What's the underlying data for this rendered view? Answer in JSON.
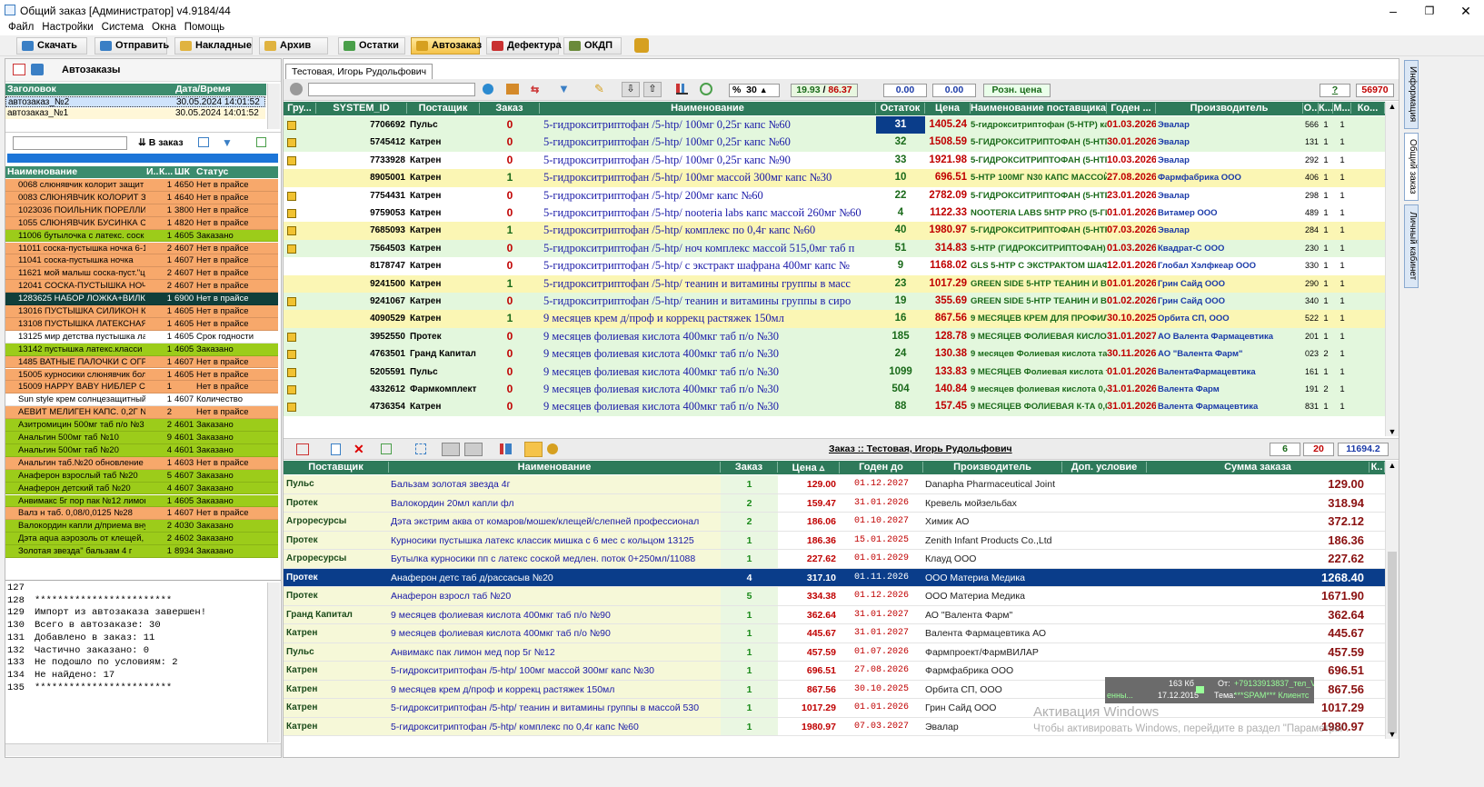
{
  "window": {
    "title": "Общий заказ [Администратор] v4.9184/44"
  },
  "menu": [
    "Файл",
    "Настройки",
    "Система",
    "Окна",
    "Помощь"
  ],
  "toolbar": [
    {
      "label": "Скачать",
      "color": "#3a7fc5"
    },
    {
      "label": "Отправить",
      "color": "#3a7fc5"
    },
    {
      "label": "Накладные",
      "color": "#e0b340"
    },
    {
      "label": "Архив",
      "color": "#e0b340"
    },
    {
      "label": "Остатки",
      "color": "#4a9f4a"
    },
    {
      "label": "Автозаказ",
      "color": "#d6a020"
    },
    {
      "label": "Дефектура",
      "color": "#c93030"
    },
    {
      "label": "ОКДП",
      "color": "#6a8a3a"
    }
  ],
  "left": {
    "title": "Автозаказы",
    "az_headers": [
      "Заголовок",
      "Дата/Время"
    ],
    "autoorders": [
      {
        "name": "автозаказ_№2",
        "date": "30.05.2024 14:01:52"
      },
      {
        "name": "автозаказ_№1",
        "date": "30.05.2024 14:01:52"
      }
    ],
    "to_order_label": "В заказ",
    "list_headers": [
      "Наименование",
      "И..",
      "К...",
      "ШК",
      "Статус"
    ],
    "items": [
      [
        "0068 слюнявчик колорит защит",
        "",
        "1",
        "4650",
        "Нет в прайсе",
        "o"
      ],
      [
        "0083 СЛЮНЯВЧИК КОЛОРИТ З",
        "",
        "1",
        "4640",
        "Нет в прайсе",
        "o"
      ],
      [
        "1023036 ПОИЛЬНИК ПОРЕЛЛИ",
        "",
        "1",
        "3800",
        "Нет в прайсе",
        "o"
      ],
      [
        "1055 СЛЮНЯВЧИК БУСИНКА С",
        "",
        "1",
        "4820",
        "Нет в прайсе",
        "o"
      ],
      [
        "11006 бутылочка с латекс. соск",
        "",
        "1",
        "4605",
        "Заказано",
        "g"
      ],
      [
        "11011 соска-пустышка ночка 6-1",
        "",
        "2",
        "4607",
        "Нет в прайсе",
        "o"
      ],
      [
        "11041 соска-пустышка ночка",
        "",
        "1",
        "4607",
        "Нет в прайсе",
        "o"
      ],
      [
        "11621 мой малыш соска-пуст.\"ц",
        "",
        "2",
        "4607",
        "Нет в прайсе",
        "o"
      ],
      [
        "12041 СОСКА-ПУСТЫШКА НОЧН",
        "",
        "2",
        "4607",
        "Нет в прайсе",
        "o"
      ],
      [
        "1283625 НАБОР ЛОЖКА+ВИЛКА",
        "",
        "1",
        "6900",
        "Нет в прайсе",
        "s"
      ],
      [
        "13016 ПУСТЫШКА СИЛИКОН К",
        "",
        "1",
        "4605",
        "Нет в прайсе",
        "o"
      ],
      [
        "13108 ПУСТЫШКА ЛАТЕКСНАЯ",
        "",
        "1",
        "4605",
        "Нет в прайсе",
        "o"
      ],
      [
        "13125 мир детства пустышка ла",
        "",
        "1",
        "4605",
        "Срок годности",
        "w"
      ],
      [
        "13142 пустышка латекс.класси",
        "",
        "1",
        "4605",
        "Заказано",
        "g"
      ],
      [
        "1485 ВАТНЫЕ ПАЛОЧКИ С ОГР",
        "",
        "1",
        "4607",
        "Нет в прайсе",
        "o"
      ],
      [
        "15005 курносики слюнявчик бол",
        "",
        "1",
        "4605",
        "Нет в прайсе",
        "o"
      ],
      [
        "15009 HAPPY BABY НИБЛЕР СИ",
        "",
        "1",
        "",
        "Нет в прайсе",
        "o"
      ],
      [
        "Sun style крем солнцезащитный",
        "",
        "1",
        "4607",
        "Количество",
        "w"
      ],
      [
        "АЕВИТ МЕЛИГЕН КАПС. 0,2Г N",
        "",
        "2",
        "",
        "Нет в прайсе",
        "o"
      ],
      [
        "Азитромицин 500мг таб п/о №3",
        "",
        "2",
        "4601",
        "Заказано",
        "g"
      ],
      [
        "Анальгин 500мг таб №10",
        "",
        "9",
        "4601",
        "Заказано",
        "g"
      ],
      [
        "Анальгин 500мг таб №20",
        "",
        "4",
        "4601",
        "Заказано",
        "g"
      ],
      [
        "Анальгин таб.№20 обновление р",
        "",
        "1",
        "4603",
        "Нет в прайсе",
        "o"
      ],
      [
        "Анаферон взрослый таб №20",
        "",
        "5",
        "4607",
        "Заказано",
        "g"
      ],
      [
        "Анаферон детский таб №20",
        "",
        "4",
        "4607",
        "Заказано",
        "g"
      ],
      [
        "Анвимакс 5г пор пак №12 лимон",
        "",
        "1",
        "4605",
        "Заказано",
        "g"
      ],
      [
        "Валз н таб. 0,08/0,0125 №28",
        "",
        "1",
        "4607",
        "Нет в прайсе",
        "o"
      ],
      [
        "Валокордин капли д/приема вну",
        "",
        "2",
        "4030",
        "Заказано",
        "g"
      ],
      [
        "Дэта aqua аэрозоль от клещей,",
        "",
        "2",
        "4602",
        "Заказано",
        "g"
      ],
      [
        "Золотая звезда\" бальзам 4 г",
        "",
        "1",
        "8934",
        "Заказано",
        "g"
      ]
    ],
    "log": [
      {
        "n": "127",
        "t": ""
      },
      {
        "n": "128",
        "t": "************************"
      },
      {
        "n": "129",
        "t": "Импорт из автозаказа завершен!"
      },
      {
        "n": "130",
        "t": "Всего в автозаказе: 30"
      },
      {
        "n": "131",
        "t": "Добавлено в заказ: 11"
      },
      {
        "n": "132",
        "t": "Частично заказано: 0"
      },
      {
        "n": "133",
        "t": "Не подошло по условиям: 2"
      },
      {
        "n": "134",
        "t": "Не найдено: 17"
      },
      {
        "n": "135",
        "t": "************************"
      }
    ]
  },
  "main": {
    "tab": "Тестовая, Игорь Рудольфович",
    "percent": "30",
    "ratio_a": "19.93",
    "ratio_sep": "/",
    "ratio_b": "86.37",
    "val1": "0.00",
    "val2": "0.00",
    "retail_price": "Розн. цена",
    "q": "?",
    "total": "56970",
    "headers": [
      "Гру...",
      "SYSTEM_ID",
      "Постащик",
      "Заказ",
      "Наименование",
      "Остаток",
      "Цена",
      "Наименование поставщика",
      "Годен ...",
      "Производитель",
      "О..",
      "К...",
      "М...",
      "Ко..."
    ],
    "rows": [
      [
        "1",
        "7706692",
        "Пульс",
        "0",
        "5-гидрокситриптофан /5-htp/ 100мг 0,25г капс №60",
        "31",
        "1405.24",
        "5-гидрокситриптофан (5-НТР) капс 100 мг х60",
        "01.03.2026",
        "Эвалар",
        "566",
        "1",
        "1",
        "g"
      ],
      [
        "1",
        "5745412",
        "Катрен",
        "0",
        "5-гидрокситриптофан /5-htp/ 100мг 0,25г капс №60",
        "32",
        "1508.59",
        "5-ГИДРОКСИТРИПТОФАН (5-НТР) 100МГ N60",
        "30.01.2026",
        "Эвалар",
        "131",
        "1",
        "1",
        "g"
      ],
      [
        "1",
        "7733928",
        "Катрен",
        "0",
        "5-гидрокситриптофан /5-htp/ 100мг 0,25г капс №90",
        "33",
        "1921.98",
        "5-ГИДРОКСИТРИПТОФАН (5-НТР) 100МГ N90",
        "10.03.2026",
        "Эвалар",
        "292",
        "1",
        "1",
        "w"
      ],
      [
        "0",
        "8905001",
        "Катрен",
        "1",
        "5-гидрокситриптофан /5-htp/ 100мг массой 300мг капс №30",
        "10",
        "696.51",
        "5-НТР 100МГ N30 КАПС МАССОЙ 300МГ",
        "27.08.2026",
        "Фармфабрика ООО",
        "406",
        "1",
        "1",
        "y"
      ],
      [
        "1",
        "7754431",
        "Катрен",
        "0",
        "5-гидрокситриптофан /5-htp/ 200мг капс №60",
        "22",
        "2782.09",
        "5-ГИДРОКСИТРИПТОФАН (5-НТР) 200МГ N60",
        "23.01.2026",
        "Эвалар",
        "298",
        "1",
        "1",
        "w"
      ],
      [
        "1",
        "9759053",
        "Катрен",
        "0",
        "5-гидрокситриптофан /5-htp/ nooteria labs капс массой 260мг №60",
        "4",
        "1122.33",
        "NOOTERIA LABS 5HTP PRO (5-ГИДРОКСИТРИПТОФАН)",
        "01.01.2026",
        "Витамер ООО",
        "489",
        "1",
        "1",
        "w"
      ],
      [
        "1",
        "7685093",
        "Катрен",
        "1",
        "5-гидрокситриптофан /5-htp/ комплекс по 0,4г капс №60",
        "40",
        "1980.97",
        "5-ГИДРОКСИТРИПТОФАН (5-НТР) КОМПЛЕКС",
        "07.03.2026",
        "Эвалар",
        "284",
        "1",
        "1",
        "y"
      ],
      [
        "1",
        "7564503",
        "Катрен",
        "0",
        "5-гидрокситриптофан /5-htp/ ноч комплекс массой 515,0мг таб п",
        "51",
        "314.83",
        "5-НТР (ГИДРОКСИТРИПТОФАН) НОЧНОЙ КОМПЛЕКС",
        "01.03.2026",
        "Квадрат-С ООО",
        "230",
        "1",
        "1",
        "g"
      ],
      [
        "0",
        "8178747",
        "Катрен",
        "0",
        "5-гидрокситриптофан /5-htp/ с экстракт шафрана 400мг капс №",
        "9",
        "1168.02",
        "GLS 5-НТР С ЭКСТРАКТОМ ШАФРАНА N120 КАПС",
        "12.01.2026",
        "Глобал Хэлфкеар ООО",
        "330",
        "1",
        "1",
        "w"
      ],
      [
        "0",
        "9241500",
        "Катрен",
        "1",
        "5-гидрокситриптофан /5-htp/ теанин и витамины группы в масс",
        "23",
        "1017.29",
        "GREEN SIDE 5-НТР ТЕАНИН И ВИТАМИНЫ ГРУППЫ",
        "01.01.2026",
        "Грин Сайд ООО",
        "290",
        "1",
        "1",
        "y"
      ],
      [
        "1",
        "9241067",
        "Катрен",
        "0",
        "5-гидрокситриптофан /5-htp/ теанин и витамины группы в сиро",
        "19",
        "355.69",
        "GREEN SIDE 5-НТР ТЕАНИН И ВИТАМИНЫ ГРУППЫ",
        "01.02.2026",
        "Грин Сайд ООО",
        "340",
        "1",
        "1",
        "g"
      ],
      [
        "0",
        "4090529",
        "Катрен",
        "1",
        "9 месяцев крем д/проф и коррекц растяжек 150мл",
        "16",
        "867.56",
        "9 МЕСЯЦЕВ КРЕМ ДЛЯ ПРОФИЛАКТИКИ КОРРЕКЦИИ",
        "30.10.2025",
        "Орбита СП, ООО",
        "522",
        "1",
        "1",
        "y"
      ],
      [
        "1",
        "3952550",
        "Протек",
        "0",
        "9 месяцев фолиевая кислота 400мкг таб п/о №30",
        "185",
        "128.78",
        "9 МЕСЯЦЕВ ФОЛИЕВАЯ КИСЛОТА ТАБ. П/О №30",
        "31.01.2027",
        "АО Валента Фармацевтика",
        "201",
        "1",
        "1",
        "g"
      ],
      [
        "1",
        "4763501",
        "Гранд Капитал",
        "0",
        "9 месяцев фолиевая кислота 400мкг таб п/о №30",
        "24",
        "130.38",
        "9 месяцев Фолиевая кислота таб. п/п/о 400мкг",
        "30.11.2026",
        "АО \"Валента Фарм\"",
        "023",
        "2",
        "1",
        "g"
      ],
      [
        "1",
        "5205591",
        "Пульс",
        "0",
        "9 месяцев фолиевая кислота 400мкг таб п/о №30",
        "1099",
        "133.83",
        "9 МЕСЯЦЕВ Фолиевая кислота табл п/о плен",
        "01.01.2026",
        "ВалентаФармацевтика",
        "161",
        "1",
        "1",
        "g"
      ],
      [
        "1",
        "4332612",
        "Фармкомплект",
        "0",
        "9 месяцев фолиевая кислота 400мкг таб п/о №30",
        "504",
        "140.84",
        "9 месяцев фолиевая кислота 0,4мг №30 таб",
        "31.01.2026",
        "Валента Фарм",
        "191",
        "2",
        "1",
        "g"
      ],
      [
        "1",
        "4736354",
        "Катрен",
        "0",
        "9 месяцев фолиевая кислота 400мкг таб п/о №30",
        "88",
        "157.45",
        "9 МЕСЯЦЕВ ФОЛИЕВАЯ К-ТА 0,0004 N30 ТАБ.П/О",
        "31.01.2026",
        "Валента Фармацевтика",
        "831",
        "1",
        "1",
        "g"
      ]
    ],
    "order_title": "Заказ :: Тестовая, Игорь Рудольфович",
    "order_summary": [
      "6",
      "20",
      "11694.2"
    ],
    "order_headers": [
      "Поставщик",
      "Наименование",
      "Заказ",
      "Цена ▵",
      "Годен до",
      "Производитель",
      "Доп. условие",
      "Сумма заказа",
      "К.."
    ],
    "order_rows": [
      [
        "Пульс",
        "Бальзам золотая звезда 4г",
        "1",
        "129.00",
        "01.12.2027",
        "Danapha Pharmaceutical Joint",
        "",
        "129.00"
      ],
      [
        "Протек",
        "Валокордин 20мл капли фл",
        "2",
        "159.47",
        "31.01.2026",
        "Кревель мойзельбах",
        "",
        "318.94"
      ],
      [
        "Агроресурсы",
        "Дэта экстрим аква от комаров/мошек/клещей/слепней профессионал",
        "2",
        "186.06",
        "01.10.2027",
        "Химик АО",
        "",
        "372.12"
      ],
      [
        "Протек",
        "Курносики пустышка латекс классик мишка с 6 мес с кольцом 13125",
        "1",
        "186.36",
        "15.01.2025",
        "Zenith Infant Products Co.,Ltd",
        "",
        "186.36"
      ],
      [
        "Агроресурсы",
        "Бутылка курносики пп с латекс соской медлен. поток 0+250мл/11088",
        "1",
        "227.62",
        "01.01.2029",
        "Клауд ООО",
        "",
        "227.62"
      ],
      [
        "Протек",
        "Анаферон детс таб д/рассасыв №20",
        "4",
        "317.10",
        "01.11.2026",
        "ООО Материа Медика",
        "",
        "1268.40"
      ],
      [
        "Протек",
        "Анаферон взросл таб №20",
        "5",
        "334.38",
        "01.12.2026",
        "ООО Материа Медика",
        "",
        "1671.90"
      ],
      [
        "Гранд Капитал",
        "9 месяцев фолиевая кислота 400мкг таб п/о №90",
        "1",
        "362.64",
        "31.01.2027",
        "АО \"Валента Фарм\"",
        "",
        "362.64"
      ],
      [
        "Катрен",
        "9 месяцев фолиевая кислота 400мкг таб п/о №90",
        "1",
        "445.67",
        "31.01.2027",
        "Валента Фармацевтика АО",
        "",
        "445.67"
      ],
      [
        "Пульс",
        "Анвимакс пак лимон мед пор 5г №12",
        "1",
        "457.59",
        "01.07.2026",
        "Фармпроект/ФармВИЛАР",
        "",
        "457.59"
      ],
      [
        "Катрен",
        "5-гидрокситриптофан /5-htp/ 100мг массой 300мг капс №30",
        "1",
        "696.51",
        "27.08.2026",
        "Фармфабрика ООО",
        "",
        "696.51"
      ],
      [
        "Катрен",
        "9 месяцев крем д/проф и коррекц растяжек 150мл",
        "1",
        "867.56",
        "30.10.2025",
        "Орбита СП, ООО",
        "",
        "867.56"
      ],
      [
        "Катрен",
        "5-гидрокситриптофан /5-htp/ теанин и витамины группы в массой 530",
        "1",
        "1017.29",
        "01.01.2026",
        "Грин Сайд ООО",
        "",
        "1017.29"
      ],
      [
        "Катрен",
        "5-гидрокситриптофан /5-htp/ комплекс по 0,4г капс №60",
        "1",
        "1980.97",
        "07.03.2027",
        "Эвалар",
        "",
        "1980.97"
      ]
    ],
    "selected_order_row": 5
  },
  "side_tabs": [
    "Информация",
    "Общий заказ",
    "Личный кабинет"
  ],
  "mail_popup": {
    "size": "163 Кб",
    "date": "17.12.2015",
    "from_label": "От:",
    "from": "+79133913837_тел_V",
    "topic_label": "Тема:",
    "topic": "***SPAM*** Клиентс",
    "left": "енны..."
  },
  "watermark": {
    "line1": "Активация Windows",
    "line2": "Чтобы активировать Windows, перейдите в раздел \"Параметры\"."
  },
  "colors": {
    "header_green": "#2e7a5a",
    "row_green": "#e3f7dd",
    "row_yellow": "#fbf6b4",
    "row_orange": "#f4a460",
    "row_lime": "#9ccc1a",
    "select_blue": "#0a3d8a",
    "price_red": "#c00000"
  }
}
